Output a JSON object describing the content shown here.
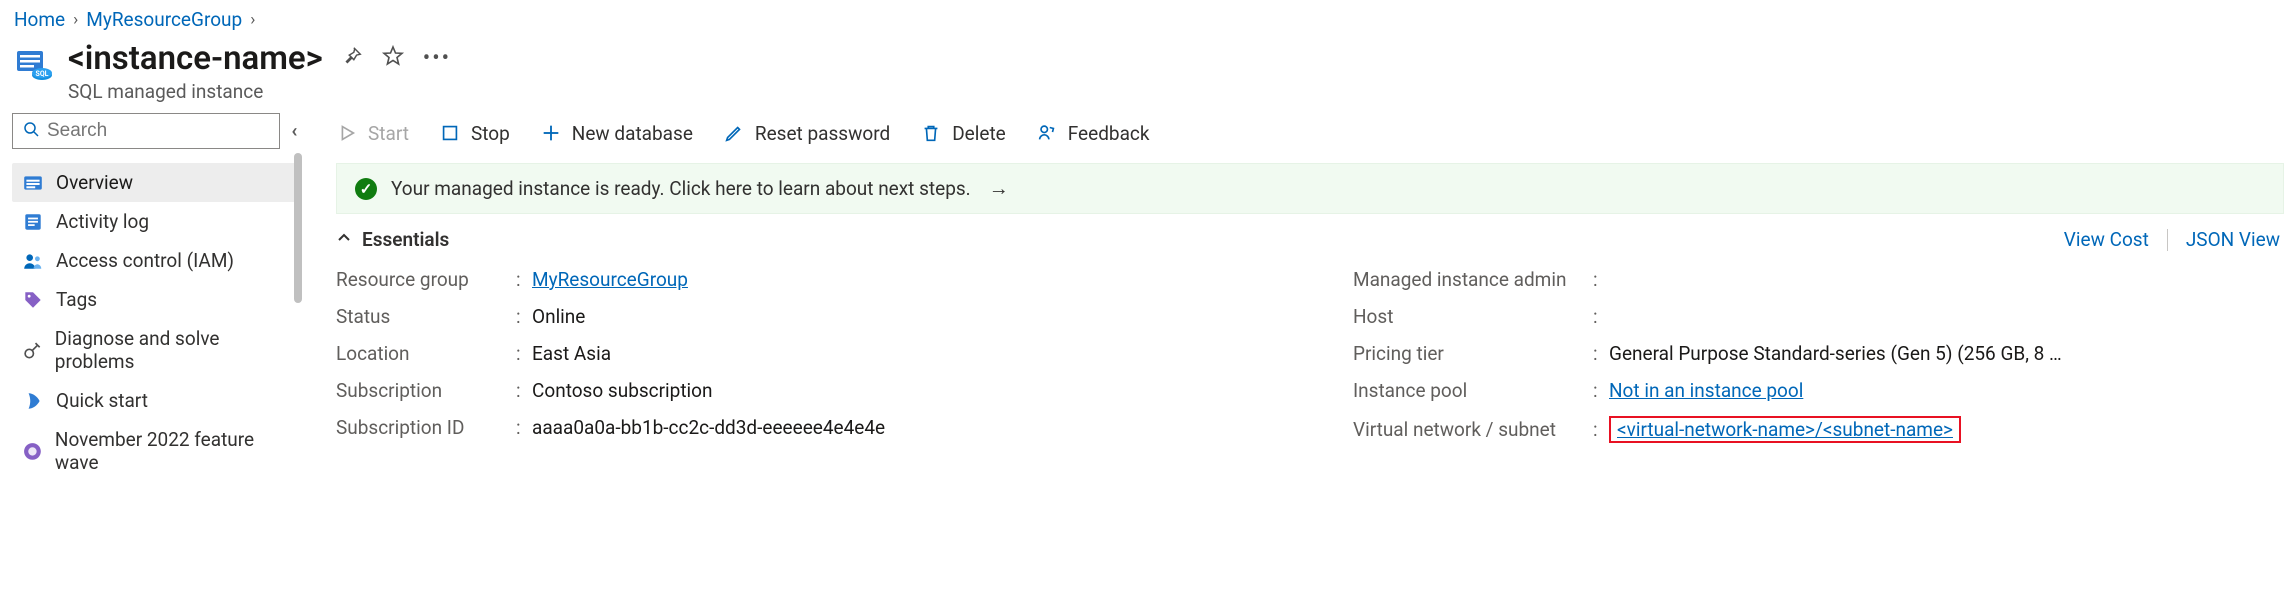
{
  "breadcrumb": {
    "home": "Home",
    "group": "MyResourceGroup"
  },
  "header": {
    "title": "<instance-name>",
    "subtitle": "SQL managed instance"
  },
  "search": {
    "placeholder": "Search"
  },
  "sidebar": {
    "items": [
      {
        "label": "Overview"
      },
      {
        "label": "Activity log"
      },
      {
        "label": "Access control (IAM)"
      },
      {
        "label": "Tags"
      },
      {
        "label": "Diagnose and solve problems"
      },
      {
        "label": "Quick start"
      },
      {
        "label": "November 2022 feature wave"
      }
    ]
  },
  "toolbar": {
    "start": "Start",
    "stop": "Stop",
    "new_db": "New database",
    "reset_pw": "Reset password",
    "delete": "Delete",
    "feedback": "Feedback"
  },
  "banner": {
    "text": "Your managed instance is ready. Click here to learn about next steps."
  },
  "essentials": {
    "title": "Essentials",
    "view_cost": "View Cost",
    "json_view": "JSON View"
  },
  "props_left": {
    "resource_group_label": "Resource group",
    "resource_group_value": "MyResourceGroup",
    "status_label": "Status",
    "status_value": "Online",
    "location_label": "Location",
    "location_value": "East Asia",
    "subscription_label": "Subscription",
    "subscription_value": "Contoso subscription",
    "subscription_id_label": "Subscription ID",
    "subscription_id_value": "aaaa0a0a-bb1b-cc2c-dd3d-eeeeee4e4e4e"
  },
  "props_right": {
    "admin_label": "Managed instance admin",
    "admin_value": "",
    "host_label": "Host",
    "host_value": "",
    "tier_label": "Pricing tier",
    "tier_value": "General Purpose Standard-series (Gen 5) (256 GB, 8 …",
    "pool_label": "Instance pool",
    "pool_value": "Not in an instance pool",
    "vnet_label": "Virtual network / subnet",
    "vnet_value": "<virtual-network-name>/<subnet-name>"
  }
}
